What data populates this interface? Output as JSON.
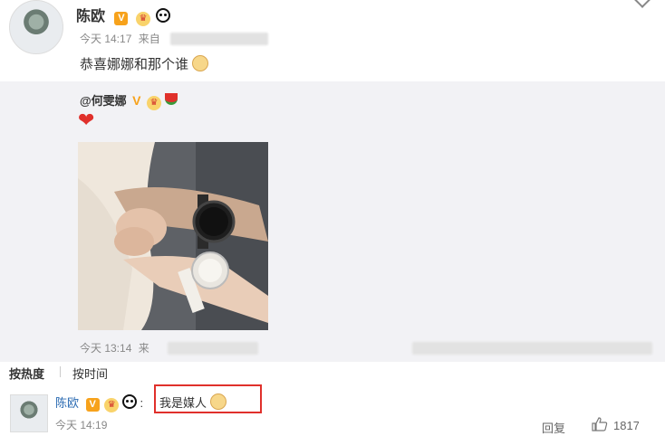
{
  "post": {
    "username": "陈欧",
    "verified": "V",
    "time": "今天 14:17",
    "from_prefix": "来自",
    "text": "恭喜娜娜和那个谁",
    "emoji_icon": "dog-face-icon"
  },
  "repost": {
    "user": "@何雯娜",
    "verified": "V",
    "heart": "❤",
    "time": "今天 13:14",
    "from_prefix": "来"
  },
  "sort": {
    "hot": "按热度",
    "time": "按时间"
  },
  "comment": {
    "username": "陈欧",
    "verified": "V",
    "separator": ":",
    "text": "我是媒人",
    "time": "今天 14:19",
    "reply": "回复",
    "likes": "1817"
  },
  "colors": {
    "accent_red": "#e0302b",
    "link_blue": "#2a6ab2",
    "vip_orange": "#f7a21b",
    "repost_bg": "#f2f2f5"
  }
}
